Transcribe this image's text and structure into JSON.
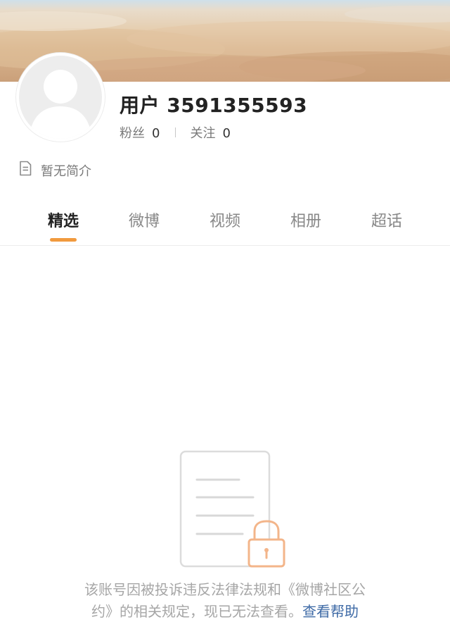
{
  "profile": {
    "username": "用户 3591355593",
    "followers_label": "粉丝",
    "followers_count": "0",
    "following_label": "关注",
    "following_count": "0",
    "bio": "暂无简介"
  },
  "tabs": [
    {
      "label": "精选",
      "active": true
    },
    {
      "label": "微博",
      "active": false
    },
    {
      "label": "视频",
      "active": false
    },
    {
      "label": "相册",
      "active": false
    },
    {
      "label": "超话",
      "active": false
    }
  ],
  "notice": {
    "line1": "该账号因被投诉违反法律法规和《微博社区公",
    "line2": "约》的相关规定，现已无法查看。",
    "help_link": "查看帮助"
  },
  "colors": {
    "accent": "#f19a3e",
    "link": "#3e6aa6"
  },
  "icons": [
    "default-avatar-icon",
    "document-icon",
    "locked-document-icon"
  ]
}
